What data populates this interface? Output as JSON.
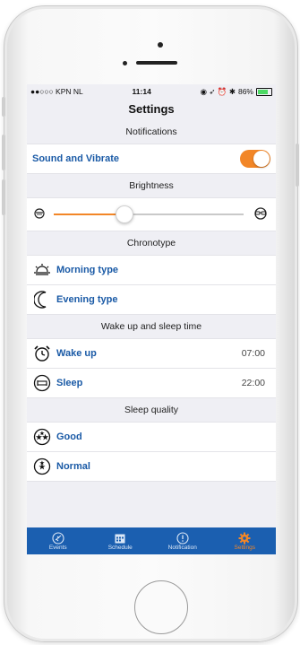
{
  "status_bar": {
    "carrier": "●●○○○ KPN NL",
    "time": "11:14",
    "battery": "86%",
    "battery_level": 0.86
  },
  "nav": {
    "title": "Settings"
  },
  "notifications": {
    "header": "Notifications",
    "sound_label": "Sound and Vibrate",
    "sound_enabled": true
  },
  "brightness": {
    "header": "Brightness",
    "level": 0.37
  },
  "chronotype": {
    "header": "Chronotype",
    "morning": "Morning type",
    "evening": "Evening type"
  },
  "wake_sleep": {
    "header": "Wake up and sleep time",
    "wake_label": "Wake up",
    "wake_time": "07:00",
    "sleep_label": "Sleep",
    "sleep_time": "22:00"
  },
  "sleep_quality": {
    "header": "Sleep quality",
    "good": "Good",
    "normal": "Normal"
  },
  "tabs": [
    {
      "label": "Events",
      "icon": "airplane-icon"
    },
    {
      "label": "Schedule",
      "icon": "calendar-icon"
    },
    {
      "label": "Notification",
      "icon": "alert-icon"
    },
    {
      "label": "Settings",
      "icon": "gear-icon"
    }
  ],
  "active_tab": "Settings",
  "colors": {
    "accent": "#f28627",
    "tabbar": "#1b5fb0",
    "label_blue": "#1a5aa6",
    "background": "#efeff4"
  }
}
